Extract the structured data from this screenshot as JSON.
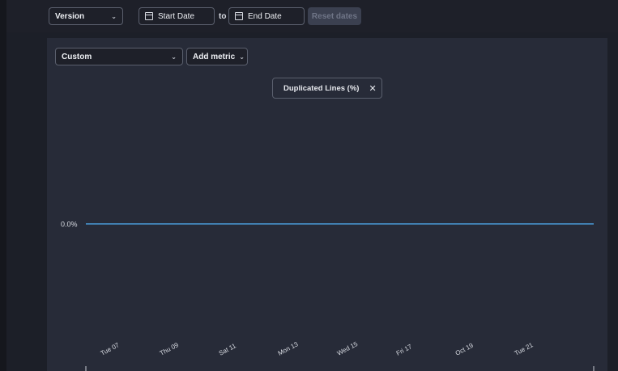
{
  "toolbar": {
    "version_select": "Version",
    "start_date": "Start Date",
    "to_label": "to",
    "end_date": "End Date",
    "reset_label": "Reset dates"
  },
  "panel": {
    "custom_select": "Custom",
    "add_metric_label": "Add metric"
  },
  "legend": {
    "entries": [
      {
        "label": "Duplicated Lines (%)",
        "color": "#4a9bd8"
      }
    ]
  },
  "icons": {
    "chevron": "chevron-down-icon",
    "calendar": "calendar-icon",
    "close": "close-icon"
  },
  "chart_data": {
    "type": "line",
    "series": [
      {
        "name": "Duplicated Lines (%)",
        "color": "#4a9bd8",
        "x": [
          "2023-11-06",
          "2023-11-25"
        ],
        "y": [
          0.0,
          0.0
        ]
      }
    ],
    "y_tick_labels": [
      "0.0%"
    ],
    "x_tick_labels": [
      "Tue 07",
      "Thu 09",
      "Sat 11",
      "Mon 13",
      "Wed 15",
      "Fri 17",
      "Oct 19",
      "Tue 21"
    ],
    "grid": false,
    "legend_placement": "top-center"
  }
}
